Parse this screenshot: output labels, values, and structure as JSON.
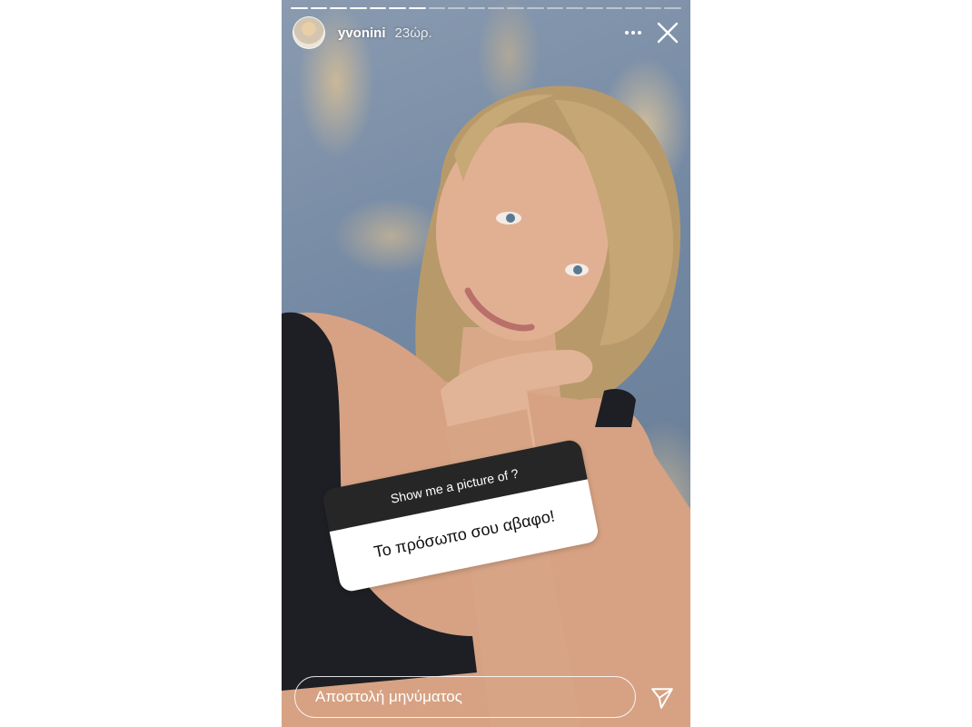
{
  "story": {
    "progress": {
      "segments": 20,
      "completed": 7
    },
    "header": {
      "username": "yvonini",
      "time": "23ώρ."
    },
    "sticker": {
      "question": "Show me a picture of ?",
      "answer": "Το πρόσωπο σου αβαφο!"
    },
    "reply": {
      "placeholder": "Αποστολή μηνύματος"
    },
    "icons": {
      "more": "more-options-icon",
      "close": "close-icon",
      "send": "send-icon"
    }
  }
}
